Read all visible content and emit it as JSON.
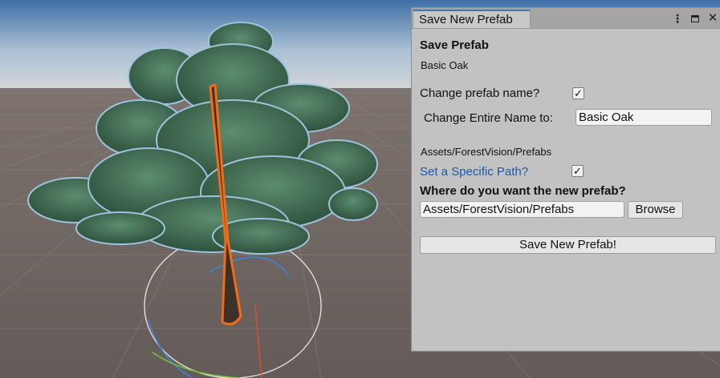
{
  "window": {
    "tab_title": "Save New Prefab",
    "icons": [
      "more-options-icon",
      "maximize-icon",
      "close-icon"
    ],
    "more_glyph": "⋮",
    "close_glyph": "✕"
  },
  "form": {
    "heading": "Save Prefab",
    "prefab_name": "Basic Oak",
    "change_name_label": "Change prefab name?",
    "change_name_checked": true,
    "entire_name_label": "Change Entire Name to:",
    "entire_name_value": "Basic Oak",
    "current_path": "Assets/ForestVision/Prefabs",
    "specific_path_label": "Set a Specific Path?",
    "specific_path_checked": true,
    "where_label": "Where do you want the new prefab?",
    "path_value": "Assets/ForestVision/Prefabs",
    "browse_label": "Browse",
    "save_label": "Save New Prefab!",
    "check_glyph": "✓"
  },
  "colors": {
    "accent": "#3a79bb",
    "link": "#1e5aa3",
    "selection_outline": "#f26a1b",
    "window_bg": "#c2c2c2"
  }
}
